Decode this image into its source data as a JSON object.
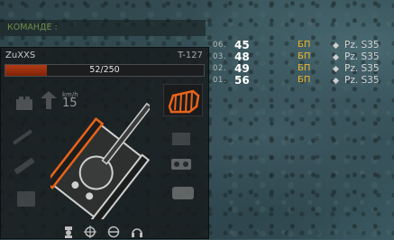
{
  "chat": {
    "channel_label": "КОМАНДЕ :"
  },
  "tank_panel": {
    "player_name": "ZuXXS",
    "tank_model": "T-127",
    "hp_current": 52,
    "hp_max": 250,
    "hp_text": "52/250",
    "speed_unit": "km/h",
    "speed_value": "15",
    "crit_module": "track-icon",
    "crew_icons": [
      "commander-icon",
      "gunner-icon",
      "driver-icon",
      "radioman-icon"
    ]
  },
  "frag_list": [
    {
      "index": "06.",
      "score": "45",
      "clan": "БП",
      "tank": "Pz. S35"
    },
    {
      "index": "03.",
      "score": "48",
      "clan": "БП",
      "tank": "Pz. S35"
    },
    {
      "index": "02.",
      "score": "49",
      "clan": "БП",
      "tank": "Pz. S35"
    },
    {
      "index": "01.",
      "score": "56",
      "clan": "БП",
      "tank": "Pz. S35"
    }
  ],
  "colors": {
    "hp_fill": "#b23a14",
    "crit_orange": "#e8641a",
    "clan_gold": "#f1b92d",
    "chat_green": "#6f8c4a"
  }
}
